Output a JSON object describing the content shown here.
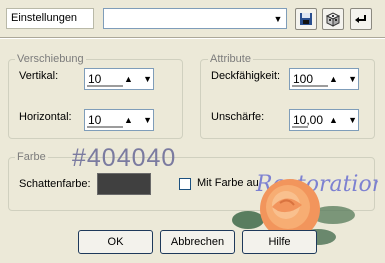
{
  "toolbar": {
    "preset_button_label": "Einstellungen",
    "preset_combo_value": "",
    "save_icon": "floppy-disk-icon",
    "random_icon": "dice-icon",
    "reset_icon": "undo-arrow-icon"
  },
  "shift_group": {
    "title": "Verschiebung",
    "vertical_label": "Vertikal:",
    "vertical_value": "10",
    "horizontal_label": "Horizontal:",
    "horizontal_value": "10"
  },
  "attribute_group": {
    "title": "Attribute",
    "opacity_label": "Deckfähigkeit:",
    "opacity_value": "100",
    "blur_label": "Unschärfe:",
    "blur_value": "10,00"
  },
  "color_group": {
    "title": "Farbe",
    "shadow_color_label": "Schattenfarbe:",
    "shadow_color": "#404040",
    "overlay_hex": "#404040",
    "fill_checkbox_label": "Mit Farbe ausfüll",
    "fill_checked": false
  },
  "watermark": {
    "text": "Restoration"
  },
  "buttons": {
    "ok": "OK",
    "cancel": "Abbrechen",
    "help": "Hilfe"
  }
}
